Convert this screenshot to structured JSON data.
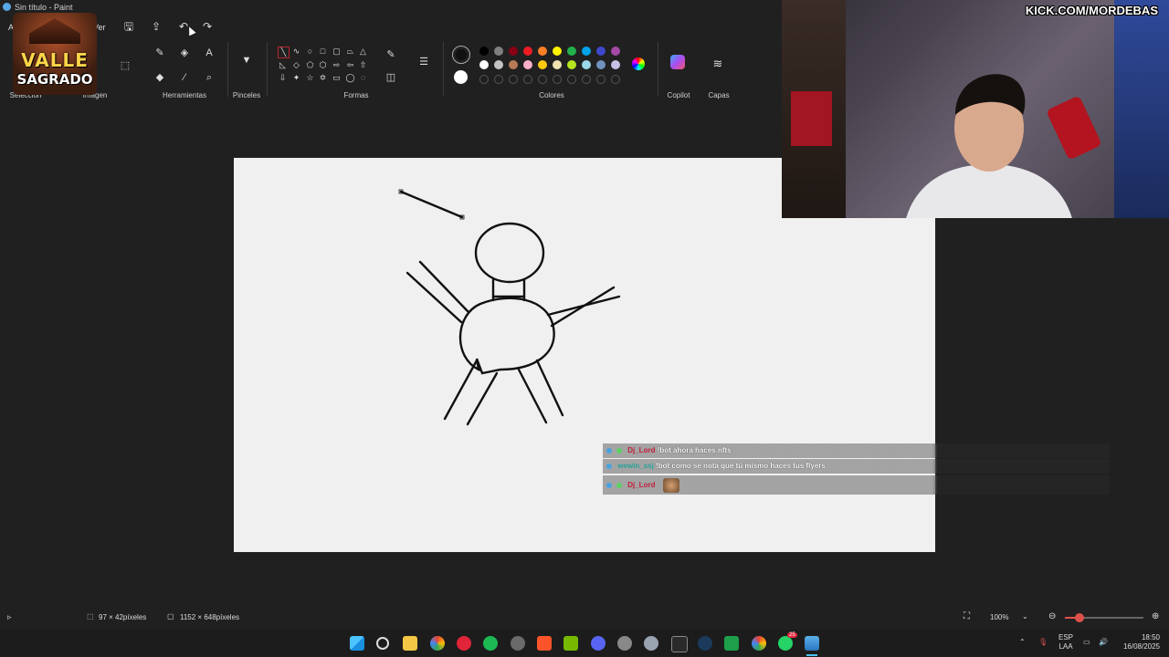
{
  "window": {
    "title": "Sin título - Paint"
  },
  "menu": {
    "file": "Arch",
    "view": "Ver"
  },
  "logo": {
    "line1": "VALLE",
    "line2": "SAGRADO"
  },
  "ribbon": {
    "groups": {
      "selection": "Selección",
      "image": "Imagen",
      "tools": "Herramientas",
      "brushes": "Pinceles",
      "shapes": "Formas",
      "colors": "Colores",
      "copilot": "Copilot",
      "layers": "Capas"
    }
  },
  "colors": {
    "primary": "#111111",
    "secondary": "#ffffff",
    "row1": [
      "#000000",
      "#7f7f7f",
      "#880015",
      "#ed1c24",
      "#ff7f27",
      "#fff200",
      "#22b14c",
      "#00a2e8",
      "#3f48cc",
      "#a349a4"
    ],
    "row2": [
      "#ffffff",
      "#c3c3c3",
      "#b97a57",
      "#ffaec9",
      "#ffc90e",
      "#efe4b0",
      "#b5e61d",
      "#99d9ea",
      "#7092be",
      "#c8bfe7"
    ]
  },
  "webcam": {
    "overlay_text": "KICK.COM/MORDEBAS"
  },
  "chat": [
    {
      "user": "Dj_Lord",
      "user_color": "#c0203a",
      "message": "!bot ahora haces nfts"
    },
    {
      "user": "wewin_ssj",
      "user_color": "#2aa198",
      "message": "!bot como se nota que tú mismo haces tus flyers"
    },
    {
      "user": "Dj_Lord",
      "user_color": "#c0203a",
      "message": ""
    }
  ],
  "status": {
    "selection_size": "97 × 42píxeles",
    "canvas_size": "1152 × 648píxeles",
    "zoom": "100%"
  },
  "tray": {
    "lang1": "ESP",
    "lang2": "LAA",
    "time": "18:50",
    "date": "16/08/2025",
    "badge_count": "25"
  }
}
